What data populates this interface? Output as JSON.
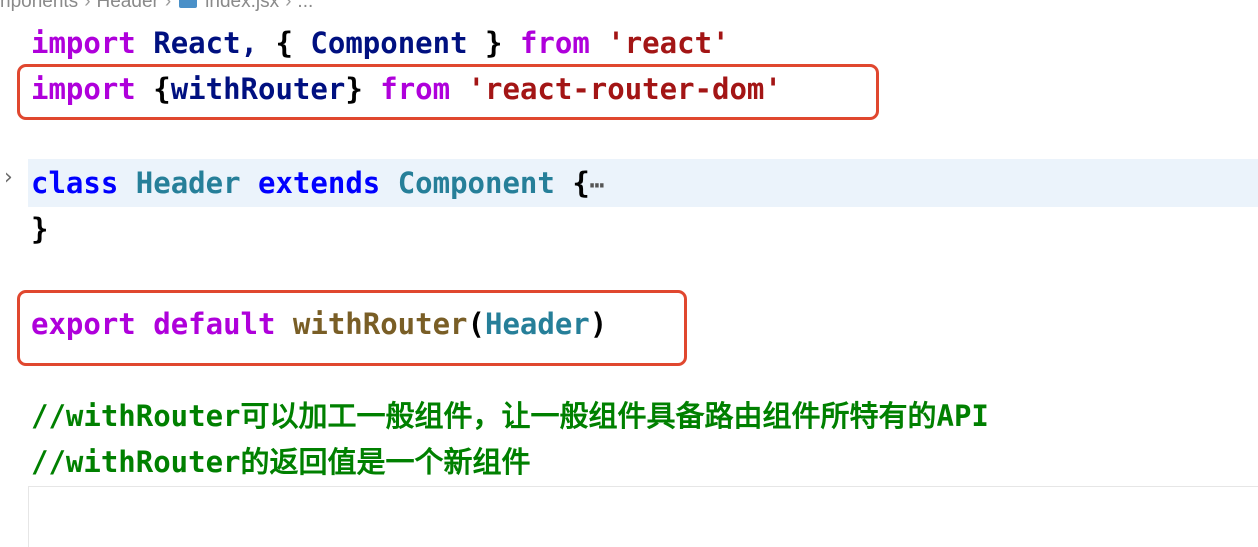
{
  "breadcrumb": {
    "items": [
      "nponents",
      "Header",
      "index.jsx",
      "..."
    ]
  },
  "code": {
    "line1": {
      "import": "import",
      "react_ident": "React,",
      "brace_open": "{",
      "component": "Component",
      "brace_close": "}",
      "from": "from",
      "module": "'react'"
    },
    "line2": {
      "import": "import",
      "brace_open": "{",
      "with_router": "withRouter",
      "brace_close": "}",
      "from": "from",
      "module": "'react-router-dom'"
    },
    "line3": {
      "class": "class",
      "name": "Header",
      "extends": "extends",
      "base": "Component",
      "brace": "{",
      "ellipsis": "⋯"
    },
    "line4": {
      "brace": "}"
    },
    "line5": {
      "export": "export",
      "default": "default",
      "fn": "withRouter",
      "paren_open": "(",
      "arg": "Header",
      "paren_close": ")"
    },
    "comment1": "//withRouter可以加工一般组件，让一般组件具备路由组件所特有的API",
    "comment2": "//withRouter的返回值是一个新组件"
  },
  "icons": {
    "fold": "chevron-right-icon",
    "file": "jsx-file-icon"
  },
  "colors": {
    "highlight_box": "#e0472f",
    "keyword_control": "#af00db",
    "keyword": "#0000ff",
    "type": "#267f99",
    "function": "#795e26",
    "string": "#a31515",
    "comment": "#008000",
    "folded_line_bg": "#ebf3fb"
  }
}
